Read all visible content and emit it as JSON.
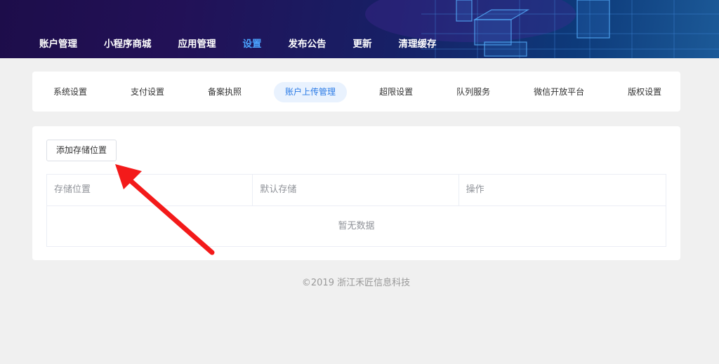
{
  "header": {
    "nav": [
      {
        "label": "账户管理",
        "active": false
      },
      {
        "label": "小程序商城",
        "active": false
      },
      {
        "label": "应用管理",
        "active": false
      },
      {
        "label": "设置",
        "active": true
      },
      {
        "label": "发布公告",
        "active": false
      },
      {
        "label": "更新",
        "active": false
      },
      {
        "label": "清理缓存",
        "active": false
      }
    ]
  },
  "settings_tabs": [
    {
      "label": "系统设置",
      "active": false
    },
    {
      "label": "支付设置",
      "active": false
    },
    {
      "label": "备案执照",
      "active": false
    },
    {
      "label": "账户上传管理",
      "active": true
    },
    {
      "label": "超限设置",
      "active": false
    },
    {
      "label": "队列服务",
      "active": false
    },
    {
      "label": "微信开放平台",
      "active": false
    },
    {
      "label": "版权设置",
      "active": false
    }
  ],
  "content": {
    "add_button_label": "添加存储位置",
    "table": {
      "columns": [
        "存储位置",
        "默认存储",
        "操作"
      ],
      "rows": [],
      "empty_text": "暂无数据"
    }
  },
  "footer": {
    "copyright": "©2019 浙江禾匠信息科技"
  },
  "colors": {
    "accent": "#2a7ae6",
    "nav_active": "#4aa3ff",
    "annotation_arrow": "#f31a1a"
  },
  "annotation": {
    "icon": "red-arrow-icon"
  }
}
